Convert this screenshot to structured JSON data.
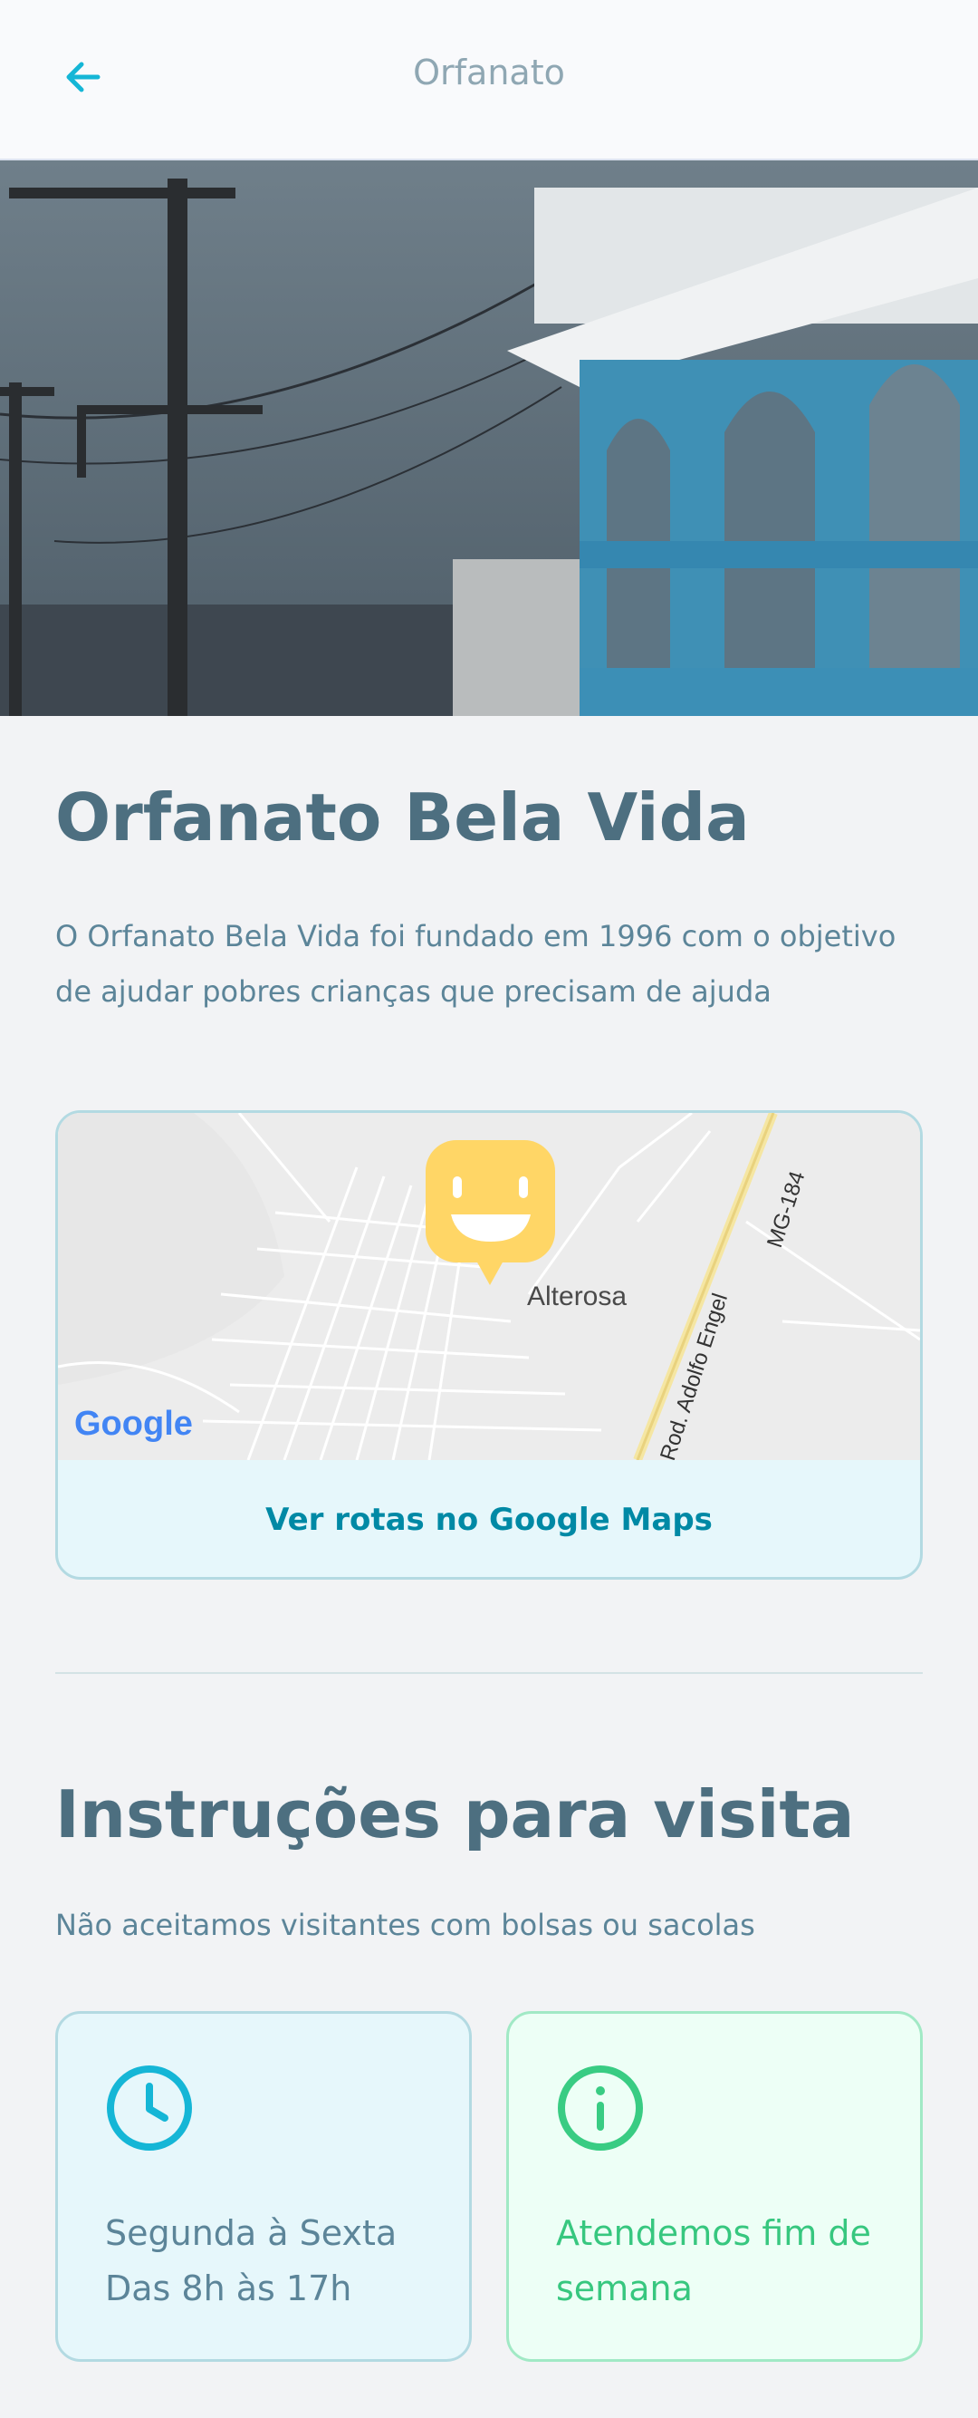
{
  "header": {
    "title": "Orfanato",
    "back_icon": "arrow-left-icon",
    "accent": "#15b6d6"
  },
  "orphanage": {
    "name": "Orfanato Bela Vida",
    "description": "O Orfanato Bela Vida foi fundado em 1996 com o objetivo de ajudar pobres crianças que precisam de ajuda"
  },
  "map": {
    "labels": {
      "town": "Alterosa",
      "road": "Rod. Adolfo Engel",
      "highway": "MG-184",
      "provider": "Google"
    },
    "marker_icon": "happy-face-marker-icon",
    "marker_color": "#ffd666",
    "link_label": "Ver rotas no Google Maps"
  },
  "visit": {
    "title": "Instruções para visita",
    "instructions": "Não aceitamos visitantes com bolsas ou sacolas",
    "hours": {
      "icon": "clock-icon",
      "line1": "Segunda à Sexta",
      "line2": "Das 8h às 17h",
      "color": "#15b6d6"
    },
    "weekend": {
      "icon": "info-icon",
      "line1": "Atendemos fim de",
      "line2": "semana",
      "color": "#39cc83"
    }
  }
}
